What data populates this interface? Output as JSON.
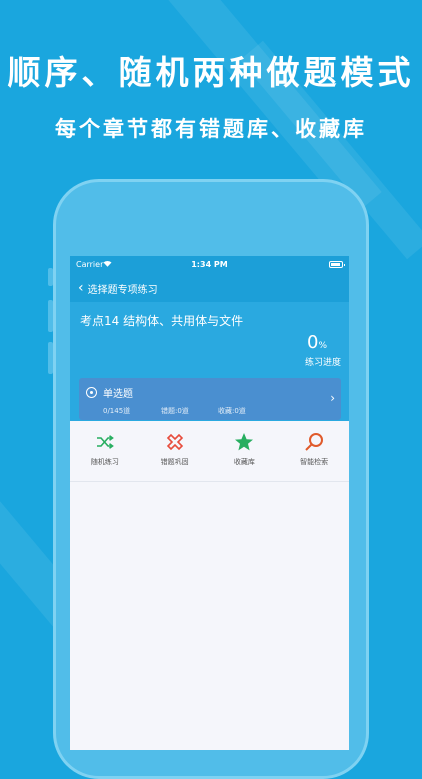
{
  "headline": {
    "title": "顺序、随机两种做题模式",
    "subtitle": "每个章节都有错题库、收藏库"
  },
  "status_bar": {
    "carrier": "Carrier",
    "time": "1:34 PM"
  },
  "nav": {
    "back_icon": "chevron-left-icon",
    "title": "选择题专项练习"
  },
  "header": {
    "topic": "考点14 结构体、共用体与文件",
    "progress_value": "0",
    "progress_unit": "%",
    "progress_label": "练习进度"
  },
  "card": {
    "name": "单选题",
    "total": "0/145道",
    "wrong": "错题:0道",
    "fav": "收藏:0道"
  },
  "actions": {
    "random": "随机练习",
    "wrong": "错题巩固",
    "fav": "收藏库",
    "search": "智能检索"
  },
  "colors": {
    "background": "#1aa6de",
    "navbar": "#1c9fd8",
    "card": "#4a8fd0",
    "random_icon": "#27ae60",
    "wrong_icon": "#e74c3c",
    "fav_icon": "#27ae60",
    "search_icon": "#e05a2b"
  }
}
